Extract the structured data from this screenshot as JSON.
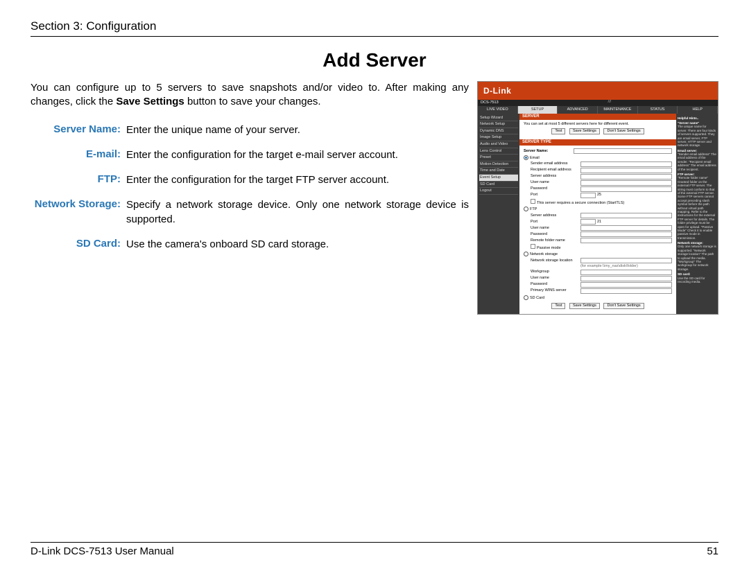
{
  "header": {
    "section": "Section 3: Configuration"
  },
  "title": "Add Server",
  "intro_pre": "You can configure up to 5 servers to save snapshots and/or video to. After making any changes, click the ",
  "intro_bold": "Save Settings",
  "intro_post": " button to save your changes.",
  "defs": [
    {
      "label": "Server Name:",
      "text": "Enter the unique name of your server."
    },
    {
      "label": "E-mail:",
      "text": "Enter the configuration for the target e-mail server account."
    },
    {
      "label": "FTP:",
      "text": "Enter the configuration for the target FTP server account."
    },
    {
      "label": "Network Storage:",
      "text": "Specify a network storage device. Only one network storage device is supported."
    },
    {
      "label": "SD Card:",
      "text": "Use the camera's onboard SD card storage."
    }
  ],
  "screenshot": {
    "brand": "D-Link",
    "model": "DCS-7513",
    "tabs": [
      "LIVE VIDEO",
      "SETUP",
      "ADVANCED",
      "MAINTENANCE",
      "STATUS",
      "HELP"
    ],
    "active_tab": "SETUP",
    "sidebar": [
      "Setup Wizard",
      "Network Setup",
      "Dynamic DNS",
      "Image Setup",
      "Audio and Video",
      "Lens Control",
      "Preset",
      "Motion Detection",
      "Time and Date",
      "Event Setup",
      "SD Card",
      "Logout"
    ],
    "sidebar_sel": "Event Setup",
    "panel_title": "SERVER",
    "panel_note": "You can set at most 5 different servers here for different event.",
    "buttons": [
      "Test",
      "Save Settings",
      "Don't Save Settings"
    ],
    "section_type": "SERVER TYPE",
    "server_name_label": "Server Name:",
    "opts": {
      "email": "Email",
      "ftp": "FTP",
      "ns": "Network storage",
      "sd": "SD Card"
    },
    "email_fields": [
      "Sender email address",
      "Recipient email address",
      "Server address",
      "User name",
      "Password",
      "Port"
    ],
    "email_port_default": "25",
    "email_tls": "This server requires a secure connection (StartTLS)",
    "ftp_fields": [
      "Server address",
      "Port",
      "User name",
      "Password",
      "Remote folder name"
    ],
    "ftp_port_default": "21",
    "ftp_passive": "Passive mode",
    "ns_fields": [
      "Network storage location",
      "(for example:\\\\my_nas\\disk\\folder)",
      "Workgroup",
      "User name",
      "Password",
      "Primary WINS server"
    ],
    "help": {
      "title": "Helpful Hints..",
      "h1": "\"Server name\"",
      "t1": "The unique name for server. There are four kinds of servers supported. They are email server, FTP server, HTTP server and network storage.",
      "h2": "Email server:",
      "t2": "\"Sender email address\" The email address of the sender. \"Recipient email address\" The email address of the recipient.",
      "h3": "FTP server:",
      "t3": "\"Remote folder name\" Granted folder on the external FTP server. The string must conform to that of the external FTP server. Some FTP servers cannot accept preceding slash symbol before the path without virtual path mapping. Refer to the instructions for the external FTP server for details. The folder privilege must be open for upload. \"Passive Mode\" Check it to enable passive mode in transmission.",
      "h4": "Network storage:",
      "t4": "Only one network storage is supported. \"Network storage location\" The path to upload the media. \"Workgroup\" The workgroup for network storage.",
      "h5": "SD card:",
      "t5": "Use the SD card for recording media."
    }
  },
  "footer": {
    "left": "D-Link DCS-7513 User Manual",
    "right": "51"
  }
}
